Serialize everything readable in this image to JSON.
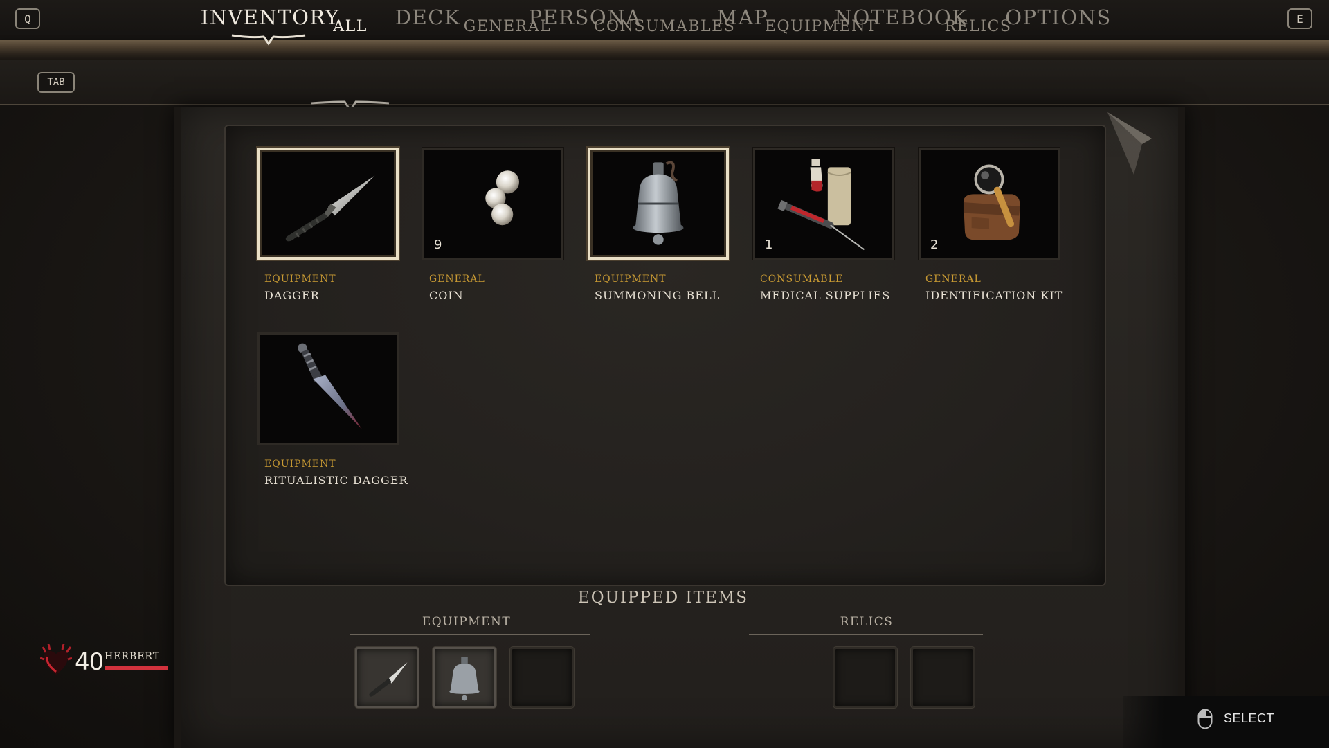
{
  "top_nav": {
    "left_key": "Q",
    "right_key": "E",
    "tabs": [
      {
        "label": "INVENTORY",
        "active": true
      },
      {
        "label": "DECK",
        "active": false
      },
      {
        "label": "PERSONA",
        "active": false
      },
      {
        "label": "MAP",
        "active": false
      },
      {
        "label": "NOTEBOOK",
        "active": false
      },
      {
        "label": "OPTIONS",
        "active": false
      }
    ]
  },
  "sub_nav": {
    "key": "TAB",
    "tabs": [
      {
        "label": "ALL",
        "active": true
      },
      {
        "label": "GENERAL",
        "active": false
      },
      {
        "label": "CONSUMABLES",
        "active": false
      },
      {
        "label": "EQUIPMENT",
        "active": false
      },
      {
        "label": "RELICS",
        "active": false
      }
    ]
  },
  "items": [
    {
      "category": "EQUIPMENT",
      "name": "DAGGER",
      "quantity": "",
      "equipped": true,
      "icon": "dagger-icon"
    },
    {
      "category": "GENERAL",
      "name": "COIN",
      "quantity": "9",
      "equipped": false,
      "icon": "coin-icon"
    },
    {
      "category": "EQUIPMENT",
      "name": "SUMMONING BELL",
      "quantity": "",
      "equipped": true,
      "icon": "bell-icon"
    },
    {
      "category": "CONSUMABLE",
      "name": "MEDICAL SUPPLIES",
      "quantity": "1",
      "equipped": false,
      "icon": "medical-supplies-icon"
    },
    {
      "category": "GENERAL",
      "name": "IDENTIFICATION KIT",
      "quantity": "2",
      "equipped": false,
      "icon": "identification-kit-icon"
    },
    {
      "category": "EQUIPMENT",
      "name": "RITUALISTIC DAGGER",
      "quantity": "",
      "equipped": false,
      "icon": "ritualistic-dagger-icon"
    }
  ],
  "equipped": {
    "title": "EQUIPPED ITEMS",
    "equipment_label": "EQUIPMENT",
    "relics_label": "RELICS",
    "equipment_slots": [
      "dagger-icon",
      "bell-icon",
      ""
    ],
    "relic_slots": [
      "",
      ""
    ]
  },
  "player": {
    "name": "HERBERT",
    "health": "40",
    "health_fraction": 1.0,
    "health_color": "#d2323d"
  },
  "prompt": {
    "label": "SELECT",
    "icon": "mouse-icon"
  },
  "colors": {
    "category": "#c89a33",
    "accent_border": "#e9dfc6"
  }
}
